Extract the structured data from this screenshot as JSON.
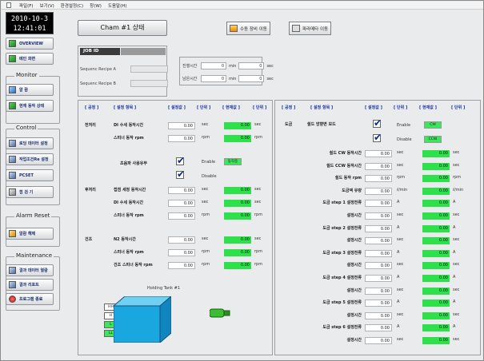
{
  "menu": [
    "파일(F)",
    "보기(V)",
    "환경설정(C)",
    "창(W)",
    "도움말(H)"
  ],
  "clock": {
    "date": "2010-10-3",
    "time": "12:41:01"
  },
  "sidebar": {
    "overview": "OVERVIEW",
    "main_screen": "메인 화면",
    "monitor_title": "Monitor",
    "monitor_items": [
      "알 람",
      "현재 동작 상태"
    ],
    "control_title": "Control",
    "control_items": [
      "로딩 데이터 설정",
      "작업조건Re 설정",
      "PCSET",
      "점 검 기"
    ],
    "alarm_reset_title": "Alarm Reset",
    "alarm_items": [
      "알람 해제"
    ],
    "maintenance_title": "Maintenance",
    "maint_items": [
      "결과 데이터 열람",
      "결과 리포트",
      "프로그램 종료"
    ]
  },
  "header": {
    "state_title": "Cham #1 상태",
    "btn_move": "수동 장비 이동",
    "btn_param": "파라메타 이동"
  },
  "job": {
    "label": "JOB ID",
    "recipe_a": "Sequenc Recipe A",
    "recipe_b": "Sequenc Recipe B"
  },
  "times": {
    "elapsed": "진행시간",
    "remain": "남은시간",
    "elapsed_min": "0",
    "elapsed_sec": "0",
    "remain_min": "0",
    "remain_sec": "0",
    "min": "min",
    "sec": "sec"
  },
  "cols": {
    "process": "[ 공정 ]",
    "item": "[ 설정 항목 ]",
    "set": "[ 설정값 ]",
    "unit": "[ 단위 ]",
    "current": "[ 현재값 ]",
    "unit2": "[ 단위 ]"
  },
  "left_rows": [
    {
      "proc": "전처리",
      "item": "DI 수세 동작시간",
      "set": "0.00",
      "unit": "sec",
      "cur": "0.00",
      "unit2": "sec"
    },
    {
      "proc": "",
      "item": "스피너 동작 rpm",
      "set": "0.00",
      "unit": "rpm",
      "cur": "0.00",
      "unit2": "rpm"
    },
    {
      "proc": "후처리",
      "item": "접점 세정 동작시간",
      "set": "0.00",
      "unit": "sec",
      "cur": "0.00",
      "unit2": "sec"
    },
    {
      "proc": "",
      "item": "DI 수세 동작시간",
      "set": "0.00",
      "unit": "sec",
      "cur": "0.00",
      "unit2": "sec"
    },
    {
      "proc": "",
      "item": "스피너 동작 rpm",
      "set": "0.00",
      "unit": "rpm",
      "cur": "0.00",
      "unit2": "rpm"
    },
    {
      "proc": "건조",
      "item": "N2 동작시간",
      "set": "0.00",
      "unit": "sec",
      "cur": "0.00",
      "unit2": "sec"
    },
    {
      "proc": "",
      "item": "스피너 동작 rpm",
      "set": "0.00",
      "unit": "rpm",
      "cur": "0.00",
      "unit2": "rpm"
    },
    {
      "proc": "",
      "item": "건조 스피너 동작 rpm",
      "set": "0.00",
      "unit": "rpm",
      "cur": "0.00",
      "unit2": "rpm"
    }
  ],
  "ultrasonic": {
    "label": "초음파 사용유무",
    "enable": "Enable",
    "disable": "Disable",
    "status": "동작중"
  },
  "tank": {
    "title": "Holding Tank #1",
    "levels": [
      "HH",
      "H",
      "L",
      "LL"
    ]
  },
  "right": {
    "proc": "도금",
    "mode": "쉴드 방향변 모드",
    "enable": "Enable",
    "disable": "Disable",
    "cw": "CW",
    "ccw": "CCW",
    "rows": [
      {
        "item": "쉴드 CW 동작시간",
        "set": "0.00",
        "unit": "sec",
        "cur": "0.00",
        "unit2": "sec"
      },
      {
        "item": "쉴드 CCW 동작시간",
        "set": "0.00",
        "unit": "sec",
        "cur": "0.00",
        "unit2": "sec"
      },
      {
        "item": "쉴드 동작 rpm",
        "set": "0.00",
        "unit": "rpm",
        "cur": "0.00",
        "unit2": "rpm"
      },
      {
        "item": "도금액 유량",
        "set": "0.00",
        "unit": "ℓ/min",
        "cur": "0.00",
        "unit2": "ℓ/min"
      },
      {
        "item": "도금 step 1 설정전류",
        "set": "0.00",
        "unit": "A",
        "cur": "0.00",
        "unit2": "A"
      },
      {
        "item": "설정시간",
        "set": "0.00",
        "unit": "sec",
        "cur": "0.00",
        "unit2": "sec"
      },
      {
        "item": "도금 step 2 설정전류",
        "set": "0.00",
        "unit": "A",
        "cur": "0.00",
        "unit2": "A"
      },
      {
        "item": "설정시간",
        "set": "0.00",
        "unit": "sec",
        "cur": "0.00",
        "unit2": "sec"
      },
      {
        "item": "도금 step 3 설정전류",
        "set": "0.00",
        "unit": "A",
        "cur": "0.00",
        "unit2": "A"
      },
      {
        "item": "설정시간",
        "set": "0.00",
        "unit": "sec",
        "cur": "0.00",
        "unit2": "sec"
      },
      {
        "item": "도금 step 4 설정전류",
        "set": "0.00",
        "unit": "A",
        "cur": "0.00",
        "unit2": "A"
      },
      {
        "item": "설정시간",
        "set": "0.00",
        "unit": "sec",
        "cur": "0.00",
        "unit2": "sec"
      },
      {
        "item": "도금 step 5 설정전류",
        "set": "0.00",
        "unit": "A",
        "cur": "0.00",
        "unit2": "A"
      },
      {
        "item": "설정시간",
        "set": "0.00",
        "unit": "sec",
        "cur": "0.00",
        "unit2": "sec"
      },
      {
        "item": "도금 step 6 설정전류",
        "set": "0.00",
        "unit": "A",
        "cur": "0.00",
        "unit2": "A"
      },
      {
        "item": "설정시간",
        "set": "0.00",
        "unit": "sec",
        "cur": "0.00",
        "unit2": "sec"
      }
    ]
  },
  "colors": {
    "accent_green": "#2ee04a",
    "header_blue": "#1d2fa0",
    "tank_blue": "#1aa7e0"
  }
}
